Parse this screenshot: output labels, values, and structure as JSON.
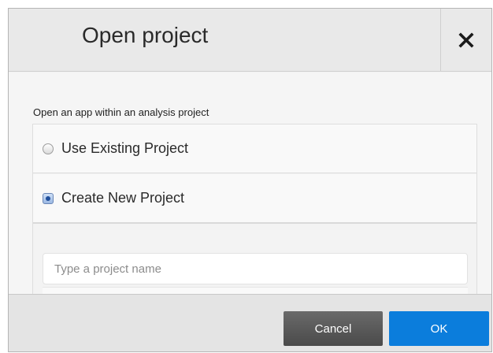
{
  "dialog": {
    "title": "Open project",
    "close_icon": "close-icon",
    "prompt": "Open an app within an analysis project",
    "options": [
      {
        "label": "Use Existing Project",
        "selected": false
      },
      {
        "label": "Create New Project",
        "selected": true
      }
    ],
    "project_name": {
      "value": "",
      "placeholder": "Type a project name"
    },
    "buttons": {
      "cancel": "Cancel",
      "ok": "OK"
    },
    "colors": {
      "ok": "#0b7ddc",
      "cancel": "#555555"
    }
  }
}
